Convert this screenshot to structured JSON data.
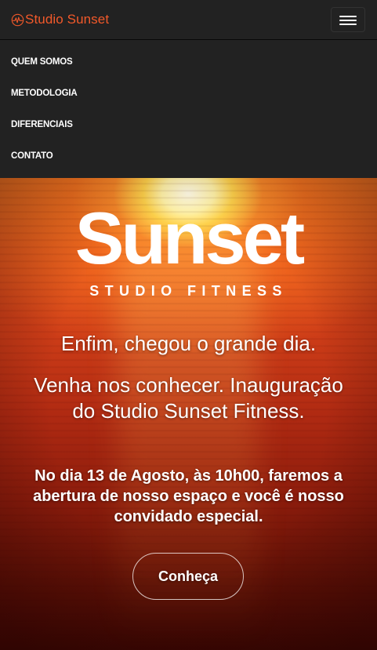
{
  "navbar": {
    "brand": "Studio Sunset",
    "brand_color": "#f2592a",
    "brand_icon": "heartbeat-circle-icon",
    "toggle_icon": "hamburger-menu-icon",
    "items": [
      {
        "label": "QUEM SOMOS"
      },
      {
        "label": "METODOLOGIA"
      },
      {
        "label": "DIFERENCIAIS"
      },
      {
        "label": "CONTATO"
      }
    ]
  },
  "hero": {
    "logo_main": "Sunset",
    "logo_sub": "STUDIO FITNESS",
    "headline": "Enfim, chegou o grande dia.",
    "subheadline": "Venha nos conhecer. Inauguração do Studio Sunset Fitness.",
    "body": "No dia 13 de Agosto, às 10h00, faremos a abertura de nosso espaço e você é nosso convidado especial.",
    "cta_label": "Conheça"
  }
}
